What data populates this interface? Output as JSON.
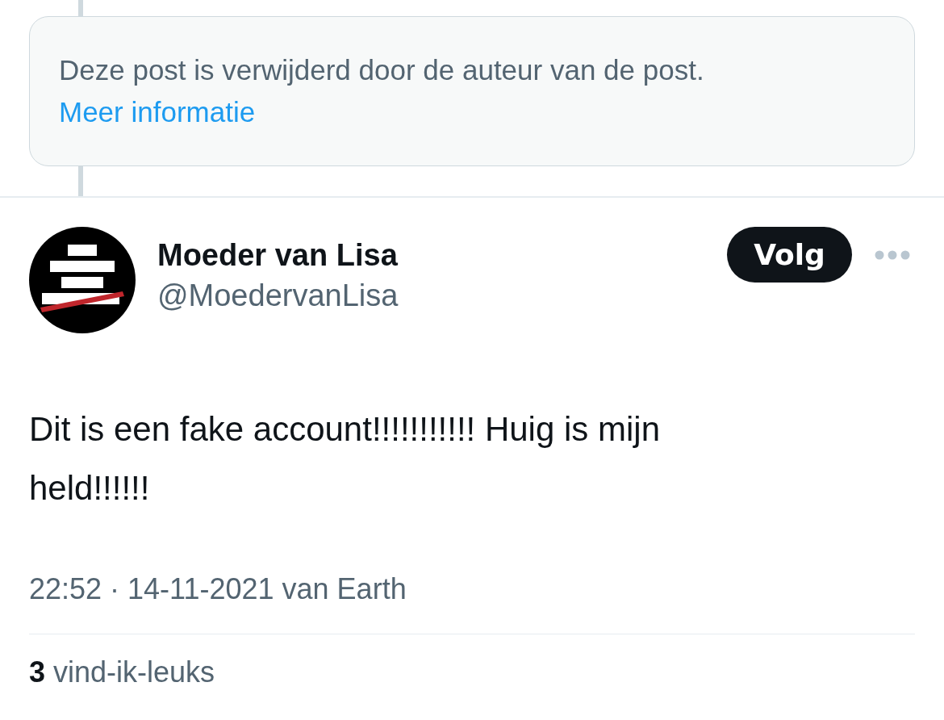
{
  "deleted_notice": {
    "message": "Deze post is verwijderd door de auteur van de post.",
    "link": "Meer informatie"
  },
  "post": {
    "author": {
      "name": "Moeder van Lisa",
      "handle": "@MoedervanLisa"
    },
    "follow_button": "Volg",
    "text": "Dit is een fake account!!!!!!!!!!! Huig is mijn held!!!!!!",
    "timestamp": "22:52 · 14-11-2021 van Earth",
    "likes": "**3** vind-ik-leuks"
  }
}
